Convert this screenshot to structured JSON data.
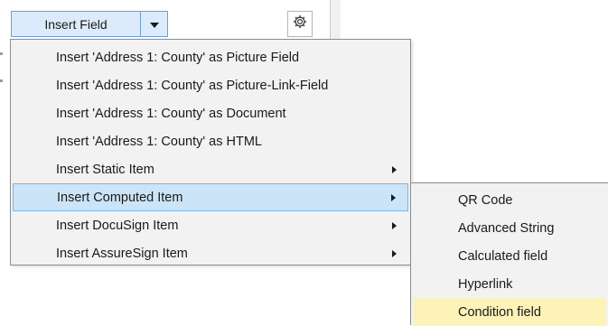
{
  "toolbar": {
    "insert_field_label": "Insert Field",
    "dropdown_icon": "chevron-down-icon",
    "settings_icon": "gear-icon"
  },
  "menu": {
    "items": [
      {
        "label": "Insert 'Address 1: County' as Picture Field",
        "has_submenu": false
      },
      {
        "label": "Insert 'Address 1: County' as Picture-Link-Field",
        "has_submenu": false
      },
      {
        "label": "Insert 'Address 1: County' as Document",
        "has_submenu": false
      },
      {
        "label": "Insert 'Address 1: County' as HTML",
        "has_submenu": false
      },
      {
        "label": "Insert Static Item",
        "has_submenu": true
      },
      {
        "label": "Insert Computed Item",
        "has_submenu": true,
        "active": true
      },
      {
        "label": "Insert DocuSign Item",
        "has_submenu": true
      },
      {
        "label": "Insert AssureSign Item",
        "has_submenu": true
      }
    ]
  },
  "submenu": {
    "items": [
      {
        "label": "QR Code"
      },
      {
        "label": "Advanced String"
      },
      {
        "label": "Calculated field"
      },
      {
        "label": "Hyperlink"
      },
      {
        "label": "Condition field",
        "highlighted": true
      }
    ]
  },
  "colors": {
    "button_bg": "#dcebfb",
    "button_border": "#6e9fd0",
    "menu_bg": "#f2f2f2",
    "active_item_bg": "#cce4f7",
    "active_item_border": "#7fb5e5",
    "hover_item_bg": "#fdf3b9"
  }
}
